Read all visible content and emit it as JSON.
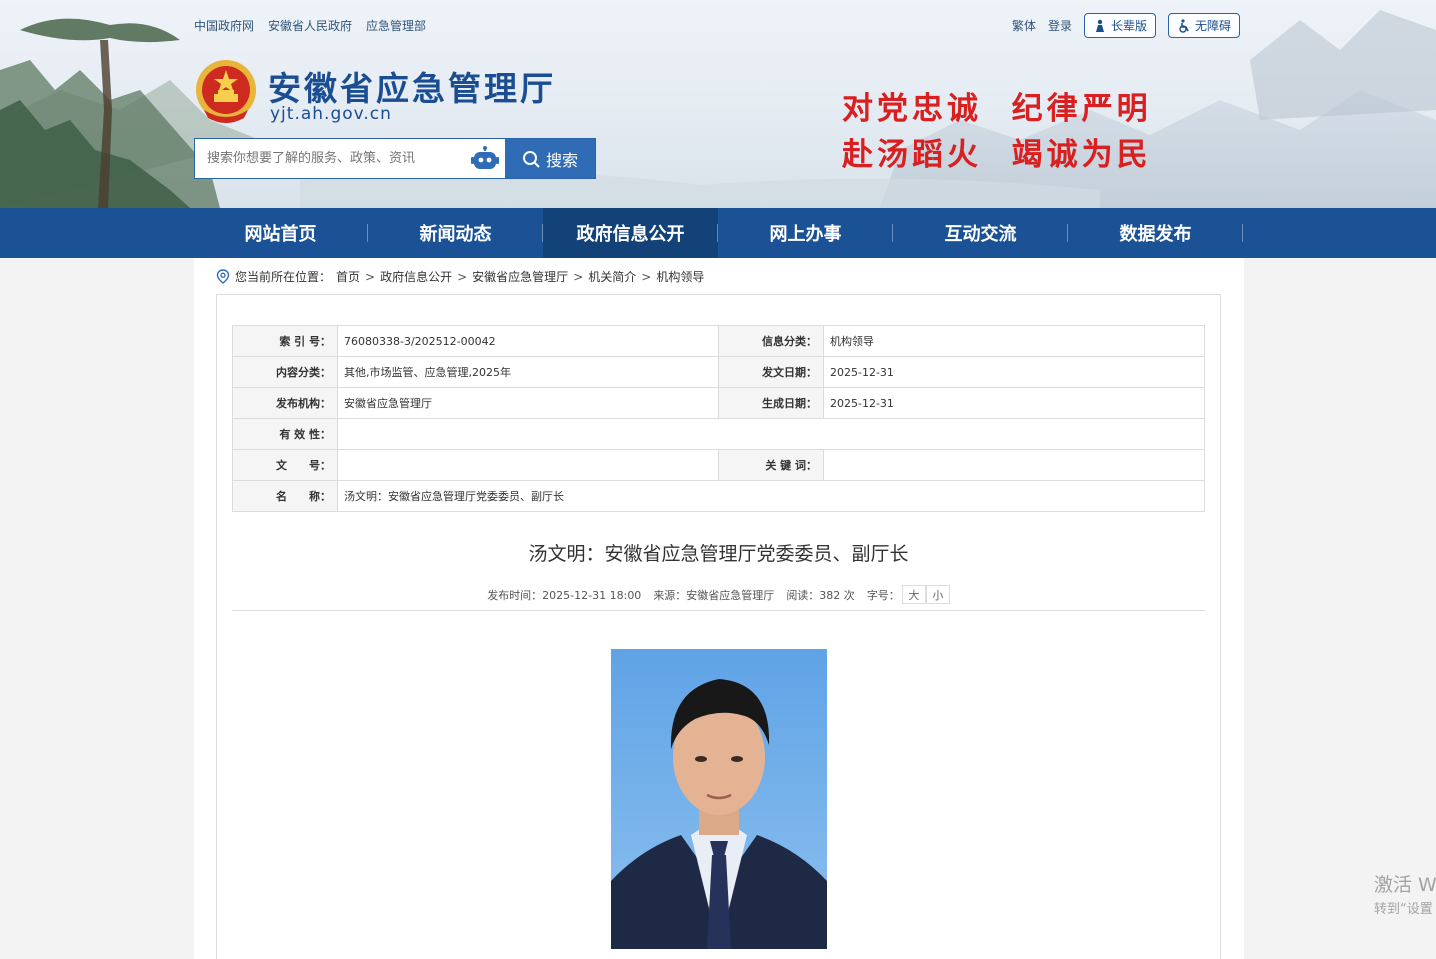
{
  "top_links": [
    "中国政府网",
    "安徽省人民政府",
    "应急管理部"
  ],
  "top_right": {
    "traditional": "繁体",
    "login": "登录",
    "elder_label": "长辈版",
    "accessible_label": "无障碍"
  },
  "site": {
    "name": "安徽省应急管理厅",
    "domain": "yjt.ah.gov.cn"
  },
  "search": {
    "placeholder": "搜索你想要了解的服务、政策、资讯",
    "button_label": "搜索"
  },
  "slogan": {
    "line1": "对党忠诚  纪律严明",
    "line2": "赴汤蹈火  竭诚为民"
  },
  "nav": {
    "items": [
      "网站首页",
      "新闻动态",
      "政府信息公开",
      "网上办事",
      "互动交流",
      "数据发布"
    ],
    "active_index": 2
  },
  "breadcrumb": {
    "prefix": "您当前所在位置：",
    "items": [
      "首页",
      "政府信息公开",
      "安徽省应急管理厅",
      "机关简介",
      "机构领导"
    ]
  },
  "meta": {
    "index_label": "索 引 号：",
    "index_value": "76080338-3/202512-00042",
    "info_class_label": "信息分类：",
    "info_class_value": "机构领导",
    "content_class_label": "内容分类：",
    "content_class_value": "其他,市场监管、应急管理,2025年",
    "issue_date_label": "发文日期：",
    "issue_date_value": "2025-12-31",
    "publisher_label": "发布机构：",
    "publisher_value": "安徽省应急管理厅",
    "created_label": "生成日期：",
    "created_value": "2025-12-31",
    "validity_label": "有 效 性：",
    "validity_value": "",
    "doc_no_label": "文　　号：",
    "doc_no_value": "",
    "keywords_label": "关 键 词：",
    "keywords_value": "",
    "name_label": "名　　称：",
    "name_value": "汤文明：安徽省应急管理厅党委委员、副厅长"
  },
  "article": {
    "title": "汤文明：安徽省应急管理厅党委委员、副厅长",
    "publish_time": "发布时间：2025-12-31 18:00",
    "source": "来源：安徽省应急管理厅",
    "views": "阅读：382 次",
    "font_size_label": "字号：",
    "font_large": "大",
    "font_small": "小"
  },
  "watermark": {
    "line1": "激活 W",
    "line2": "转到“设置"
  },
  "colors": {
    "nav_bg": "#1a5295",
    "nav_active": "#124278",
    "brand_blue": "#1a4d92",
    "slogan_red": "#d91f1f",
    "search_btn": "#2f6cb5"
  },
  "icons": [
    "location-pin-icon",
    "robot-icon",
    "search-icon",
    "elder-icon",
    "wheelchair-icon",
    "national-emblem"
  ]
}
